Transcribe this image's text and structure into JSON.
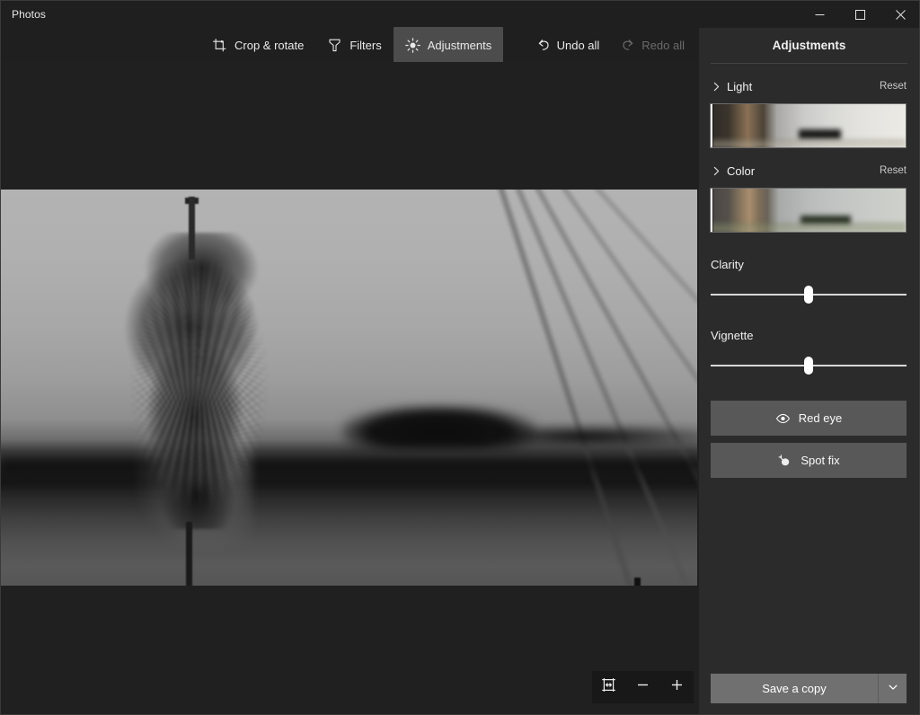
{
  "window": {
    "title": "Photos",
    "controls": [
      {
        "name": "minimize",
        "glyph": "minimize-icon"
      },
      {
        "name": "maximize",
        "glyph": "maximize-icon"
      },
      {
        "name": "close",
        "glyph": "close-icon"
      }
    ]
  },
  "toolbar": {
    "tools": [
      {
        "label": "Crop & rotate",
        "icon": "crop-rotate-icon",
        "active": false
      },
      {
        "label": "Filters",
        "icon": "filters-icon",
        "active": false
      },
      {
        "label": "Adjustments",
        "icon": "adjustments-brightness-icon",
        "active": true
      }
    ],
    "undo_label": "Undo all",
    "undo_icon": "undo-icon",
    "undo_enabled": true,
    "redo_label": "Redo all",
    "redo_icon": "redo-icon",
    "redo_enabled": false
  },
  "canvas": {
    "photo_description": "Black and white photograph of a seeding cattail plant against a blurred lake shoreline",
    "zoom_controls": [
      {
        "name": "fit-to-window",
        "icon": "fit-to-window-icon"
      },
      {
        "name": "zoom-out",
        "icon": "minus-icon"
      },
      {
        "name": "zoom-in",
        "icon": "plus-icon"
      }
    ]
  },
  "panel": {
    "title": "Adjustments",
    "sections": [
      {
        "name": "Light",
        "reset_label": "Reset",
        "chevron": "chevron-right-icon",
        "slider_value": 0
      },
      {
        "name": "Color",
        "reset_label": "Reset",
        "chevron": "chevron-right-icon",
        "slider_value": 0
      }
    ],
    "sliders": [
      {
        "label": "Clarity",
        "value": 50
      },
      {
        "label": "Vignette",
        "value": 50
      }
    ],
    "actions": [
      {
        "label": "Red eye",
        "icon": "eye-icon"
      },
      {
        "label": "Spot fix",
        "icon": "spot-fix-icon"
      }
    ],
    "save": {
      "label": "Save a copy",
      "caret_icon": "chevron-down-icon"
    }
  },
  "colors": {
    "window_bg": "#1f1f1f",
    "panel_bg": "#2b2b2b",
    "active_tool_bg": "#4c4c4c",
    "action_btn_bg": "#585858",
    "save_btn_bg": "#707070",
    "text": "#f0f0f0",
    "text_disabled": "#6b6b6b"
  }
}
